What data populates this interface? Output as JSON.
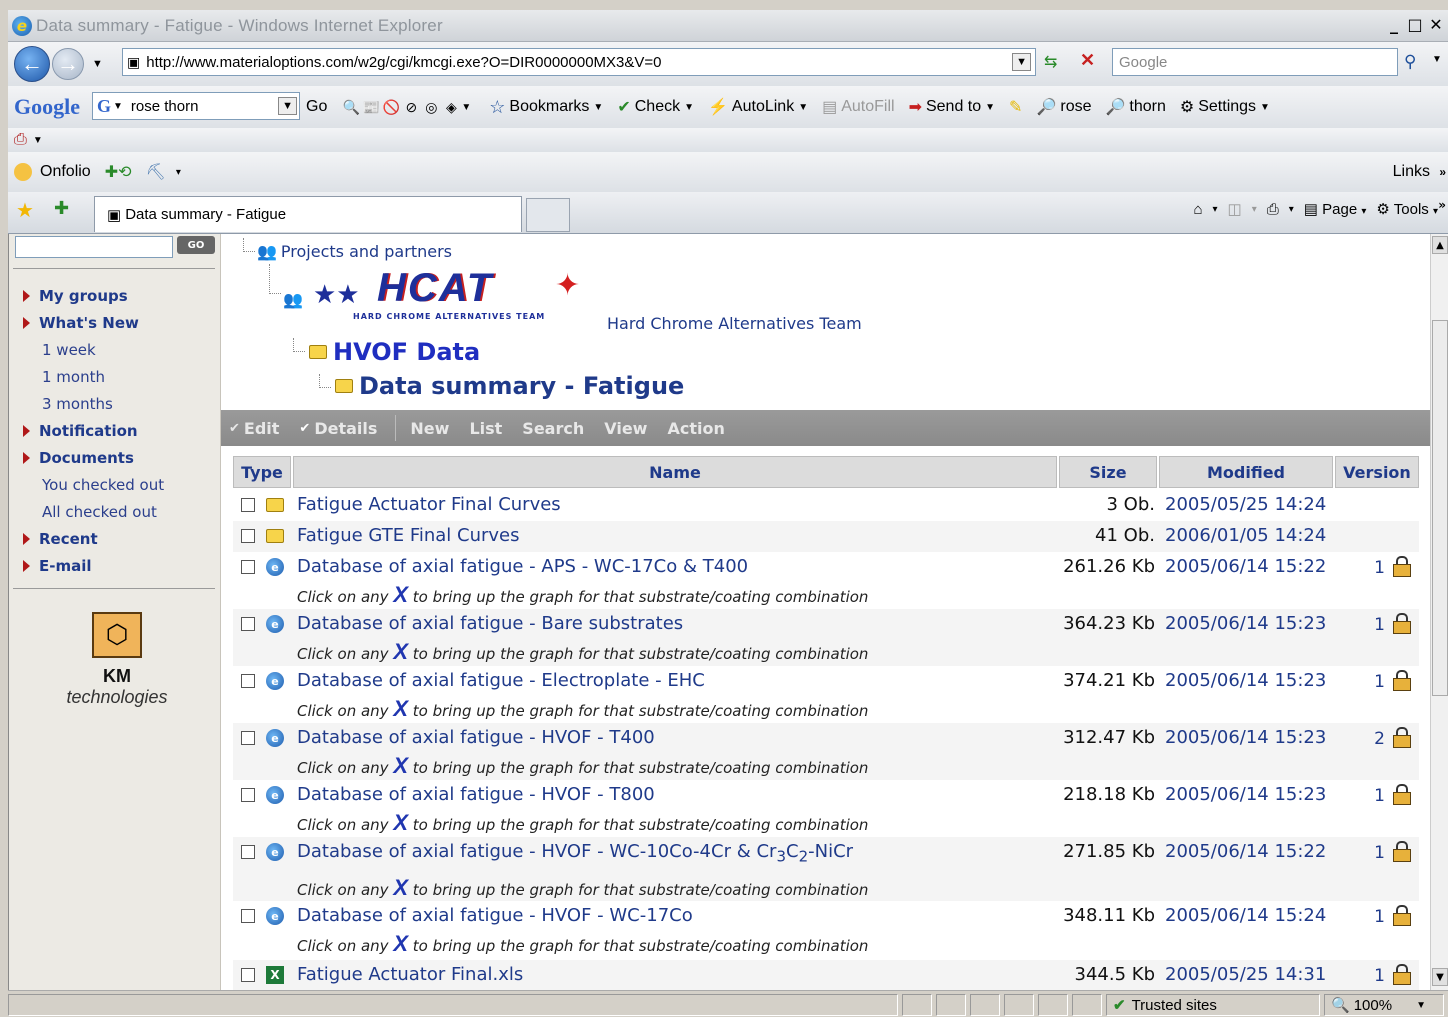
{
  "window": {
    "title": "Data summary - Fatigue - Windows Internet Explorer"
  },
  "address": {
    "url": "http://www.materialoptions.com/w2g/cgi/kmcgi.exe?O=DIR0000000MX3&V=0",
    "search_placeholder": "Google"
  },
  "google_toolbar": {
    "logo": "Google",
    "query": "rose thorn",
    "go": "Go",
    "bookmarks": "Bookmarks",
    "check": "Check",
    "autolink": "AutoLink",
    "autofill": "AutoFill",
    "sendto": "Send to",
    "term1": "rose",
    "term2": "thorn",
    "settings": "Settings"
  },
  "links_bar": {
    "onfolio": "Onfolio",
    "links": "Links"
  },
  "tab": {
    "title": "Data summary - Fatigue"
  },
  "command_bar": {
    "page": "Page",
    "tools": "Tools"
  },
  "sidebar": {
    "go": "GO",
    "items": [
      {
        "label": "My groups",
        "type": "h"
      },
      {
        "label": "What's New",
        "type": "h"
      },
      {
        "label": "1 week",
        "type": "s"
      },
      {
        "label": "1 month",
        "type": "s"
      },
      {
        "label": "3 months",
        "type": "s"
      },
      {
        "label": "Notification",
        "type": "h"
      },
      {
        "label": "Documents",
        "type": "h"
      },
      {
        "label": "You checked out",
        "type": "s"
      },
      {
        "label": "All checked out",
        "type": "s"
      },
      {
        "label": "Recent",
        "type": "h"
      },
      {
        "label": "E-mail",
        "type": "h"
      }
    ],
    "brand_km": "KM",
    "brand_rest": "technologies"
  },
  "breadcrumb": {
    "projects": "Projects and partners",
    "hcat_logo": "HCAT",
    "hcat_tagline": "HARD CHROME ALTERNATIVES TEAM",
    "hcat": "Hard Chrome Alternatives Team",
    "hvof": "HVOF Data",
    "current": "Data summary - Fatigue"
  },
  "actions": {
    "edit": "Edit",
    "details": "Details",
    "new": "New",
    "list": "List",
    "search": "Search",
    "view": "View",
    "action": "Action"
  },
  "table": {
    "headers": {
      "type": "Type",
      "name": "Name",
      "size": "Size",
      "modified": "Modified",
      "version": "Version"
    },
    "rows": [
      {
        "name": "Fatigue Actuator Final Curves",
        "size": "3 Ob.",
        "modified": "2005/05/25 14:24",
        "version": "",
        "icon": "folder-icon"
      },
      {
        "name": "Fatigue GTE Final Curves",
        "size": "41 Ob.",
        "modified": "2006/01/05 14:24",
        "version": "",
        "icon": "folder-icon"
      },
      {
        "name": "Database of axial fatigue - APS - WC-17Co & T400",
        "size": "261.26 Kb",
        "modified": "2005/06/14 15:22",
        "version": "1",
        "icon": "ie-document-icon"
      },
      {
        "name": "Database of axial fatigue - Bare substrates",
        "size": "364.23 Kb",
        "modified": "2005/06/14 15:23",
        "version": "1",
        "icon": "ie-document-icon"
      },
      {
        "name": "Database of axial fatigue - Electroplate - EHC",
        "size": "374.21 Kb",
        "modified": "2005/06/14 15:23",
        "version": "1",
        "icon": "ie-document-icon"
      },
      {
        "name": "Database of axial fatigue - HVOF - T400",
        "size": "312.47 Kb",
        "modified": "2005/06/14 15:23",
        "version": "2",
        "icon": "ie-document-icon"
      },
      {
        "name": "Database of axial fatigue - HVOF - T800",
        "size": "218.18 Kb",
        "modified": "2005/06/14 15:23",
        "version": "1",
        "icon": "ie-document-icon"
      },
      {
        "name": "Database of axial fatigue - HVOF - WC-10Co-4Cr & Cr3C2-NiCr",
        "size": "271.85 Kb",
        "modified": "2005/06/14 15:22",
        "version": "1",
        "icon": "ie-document-icon"
      },
      {
        "name": "Database of axial fatigue - HVOF - WC-17Co",
        "size": "348.11 Kb",
        "modified": "2005/06/14 15:24",
        "version": "1",
        "icon": "ie-document-icon"
      },
      {
        "name": "Fatigue Actuator Final.xls",
        "size": "344.5 Kb",
        "modified": "2005/05/25 14:31",
        "version": "1",
        "icon": "excel-icon"
      }
    ],
    "subtitle_a": "Click on any",
    "subtitle_x": "X",
    "subtitle_b": "to bring up the graph for that substrate/coating combination"
  },
  "statusbar": {
    "zone": "Trusted sites",
    "zoom": "100%"
  }
}
